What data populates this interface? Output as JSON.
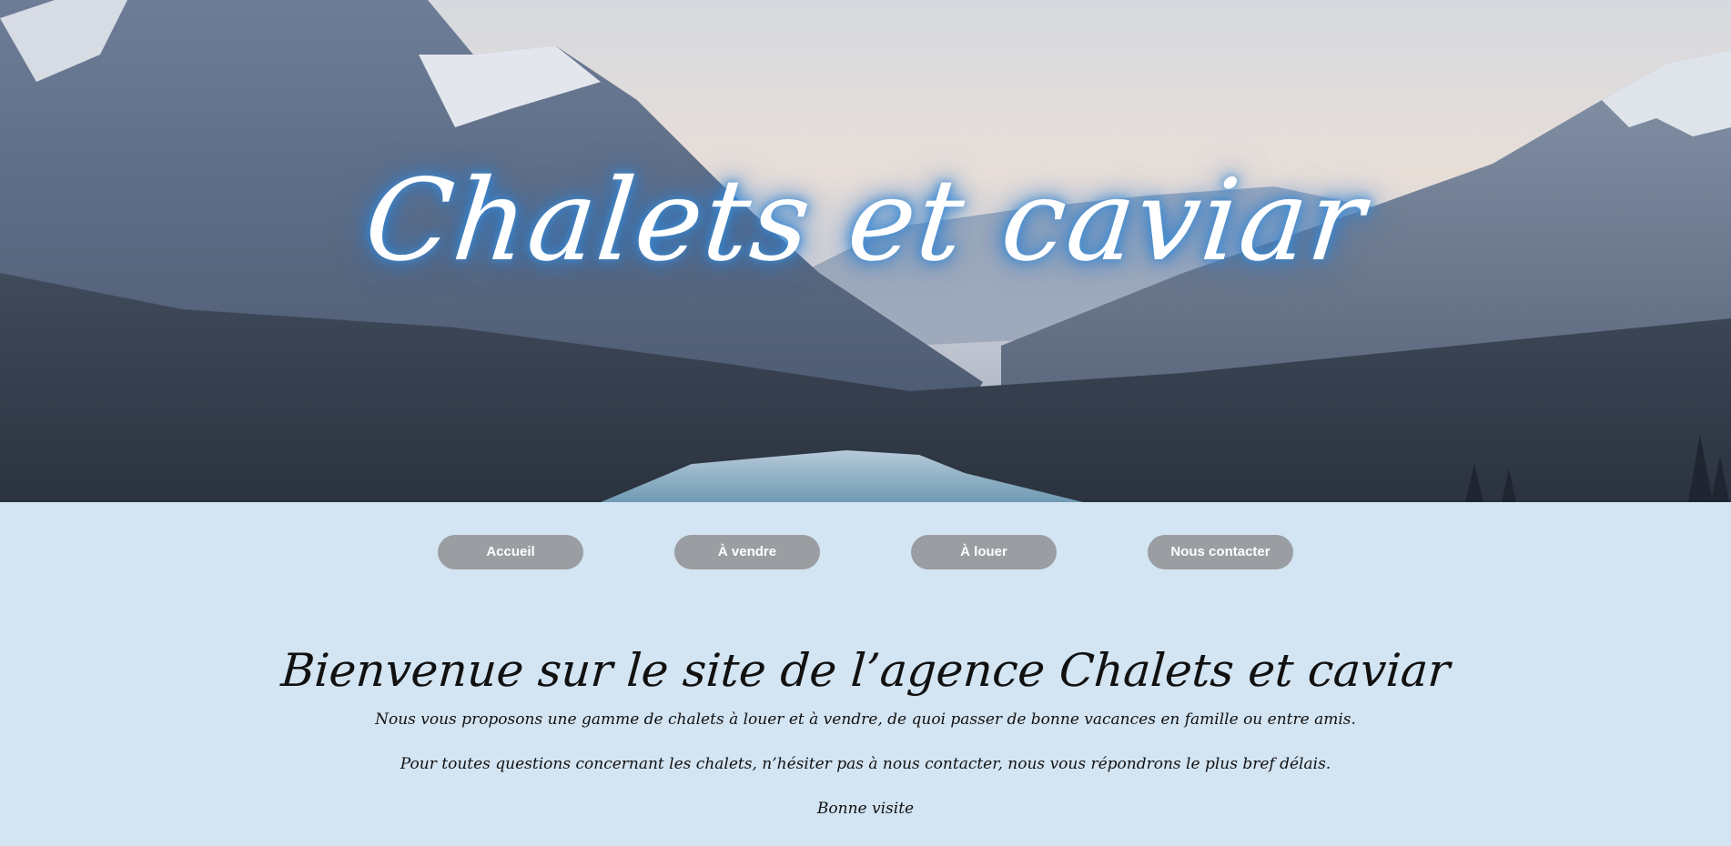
{
  "hero": {
    "title": "Chalets et caviar",
    "image": "mountain-lake-landscape"
  },
  "nav": {
    "items": [
      {
        "label": "Accueil"
      },
      {
        "label": "À vendre"
      },
      {
        "label": "À louer"
      },
      {
        "label": "Nous contacter"
      }
    ]
  },
  "content": {
    "heading": "Bienvenue sur le site de l’agence Chalets et caviar",
    "paragraph_1": "Nous vous proposons une gamme de chalets à louer et à vendre, de quoi passer de bonne vacances en famille ou entre amis.",
    "paragraph_2": "Pour toutes questions concernant les chalets, n’hésiter pas à nous contacter, nous vous répondrons le plus bref délais.",
    "paragraph_3": "Bonne visite"
  },
  "colors": {
    "page_background": "#d3e4f2",
    "nav_button": "#9a9da1",
    "title_glow": "#2b7ac9"
  }
}
